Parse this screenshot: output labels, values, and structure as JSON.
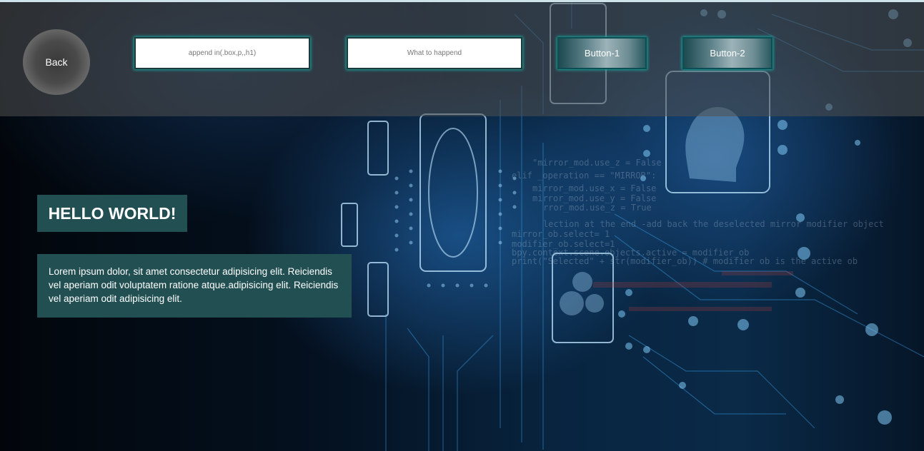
{
  "header": {
    "back_label": "Back",
    "append_input_placeholder": "append in(.box,p,,h1)",
    "what_input_placeholder": "What to happend",
    "button1_label": "Button-1",
    "button2_label": "Button-2"
  },
  "main": {
    "heading": "HELLO WORLD!",
    "paragraph": "Lorem ipsum dolor, sit amet consectetur adipisicing elit. Reiciendis vel aperiam odit voluptatem ratione atque.adipisicing elit. Reiciendis vel aperiam odit adipisicing elit."
  },
  "colors": {
    "header_overlay": "#505050",
    "box_background": "#214f52",
    "button_glow": "#1aa7a0",
    "text": "#ffffff"
  },
  "background": {
    "icon": "ai-circuit-background-image"
  }
}
